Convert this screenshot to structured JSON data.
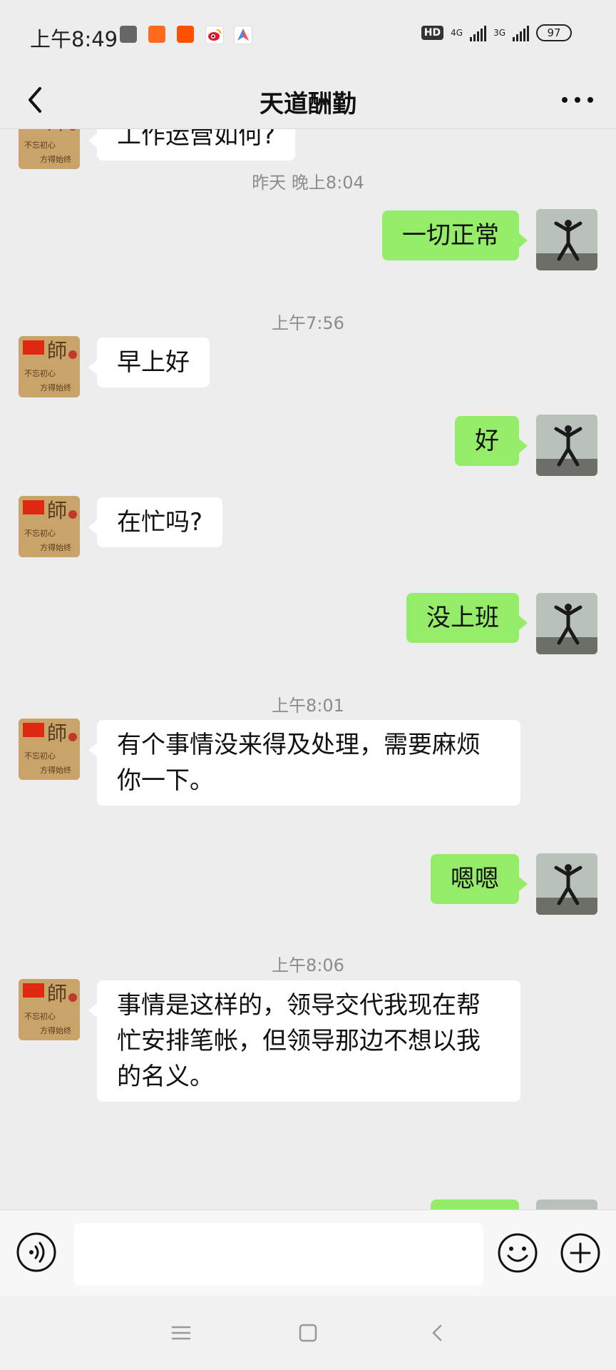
{
  "status_bar": {
    "time": "上午8:49",
    "hd_label": "HD",
    "signal_1": "4G",
    "signal_2": "3G",
    "battery": "97",
    "app_icons": [
      "wechat-sync-icon",
      "mi-icon",
      "taobao-icon",
      "weibo-icon",
      "maps-icon"
    ]
  },
  "header": {
    "title": "天道酬勤"
  },
  "messages": [
    {
      "from": "contact",
      "text": "工作运营如何?"
    },
    {
      "type": "time",
      "text": "昨天 晚上8:04"
    },
    {
      "from": "me",
      "text": "一切正常"
    },
    {
      "type": "time",
      "text": "上午7:56"
    },
    {
      "from": "contact",
      "text": "早上好"
    },
    {
      "from": "me",
      "text": "好"
    },
    {
      "from": "contact",
      "text": "在忙吗?"
    },
    {
      "from": "me",
      "text": "没上班"
    },
    {
      "type": "time",
      "text": "上午8:01"
    },
    {
      "from": "contact",
      "text": "有个事情没来得及处理，需要麻烦你一下。"
    },
    {
      "from": "me",
      "text": "嗯嗯"
    },
    {
      "type": "time",
      "text": "上午8:06"
    },
    {
      "from": "contact",
      "text": "事情是这样的，领导交代我现在帮忙安排笔帐，但领导那边不想以我的名义。"
    }
  ],
  "input": {
    "value": "",
    "placeholder": ""
  },
  "colors": {
    "background": "#ededed",
    "outgoing_bubble": "#95ec69",
    "incoming_bubble": "#ffffff",
    "timestamp": "#8c8c8c"
  }
}
